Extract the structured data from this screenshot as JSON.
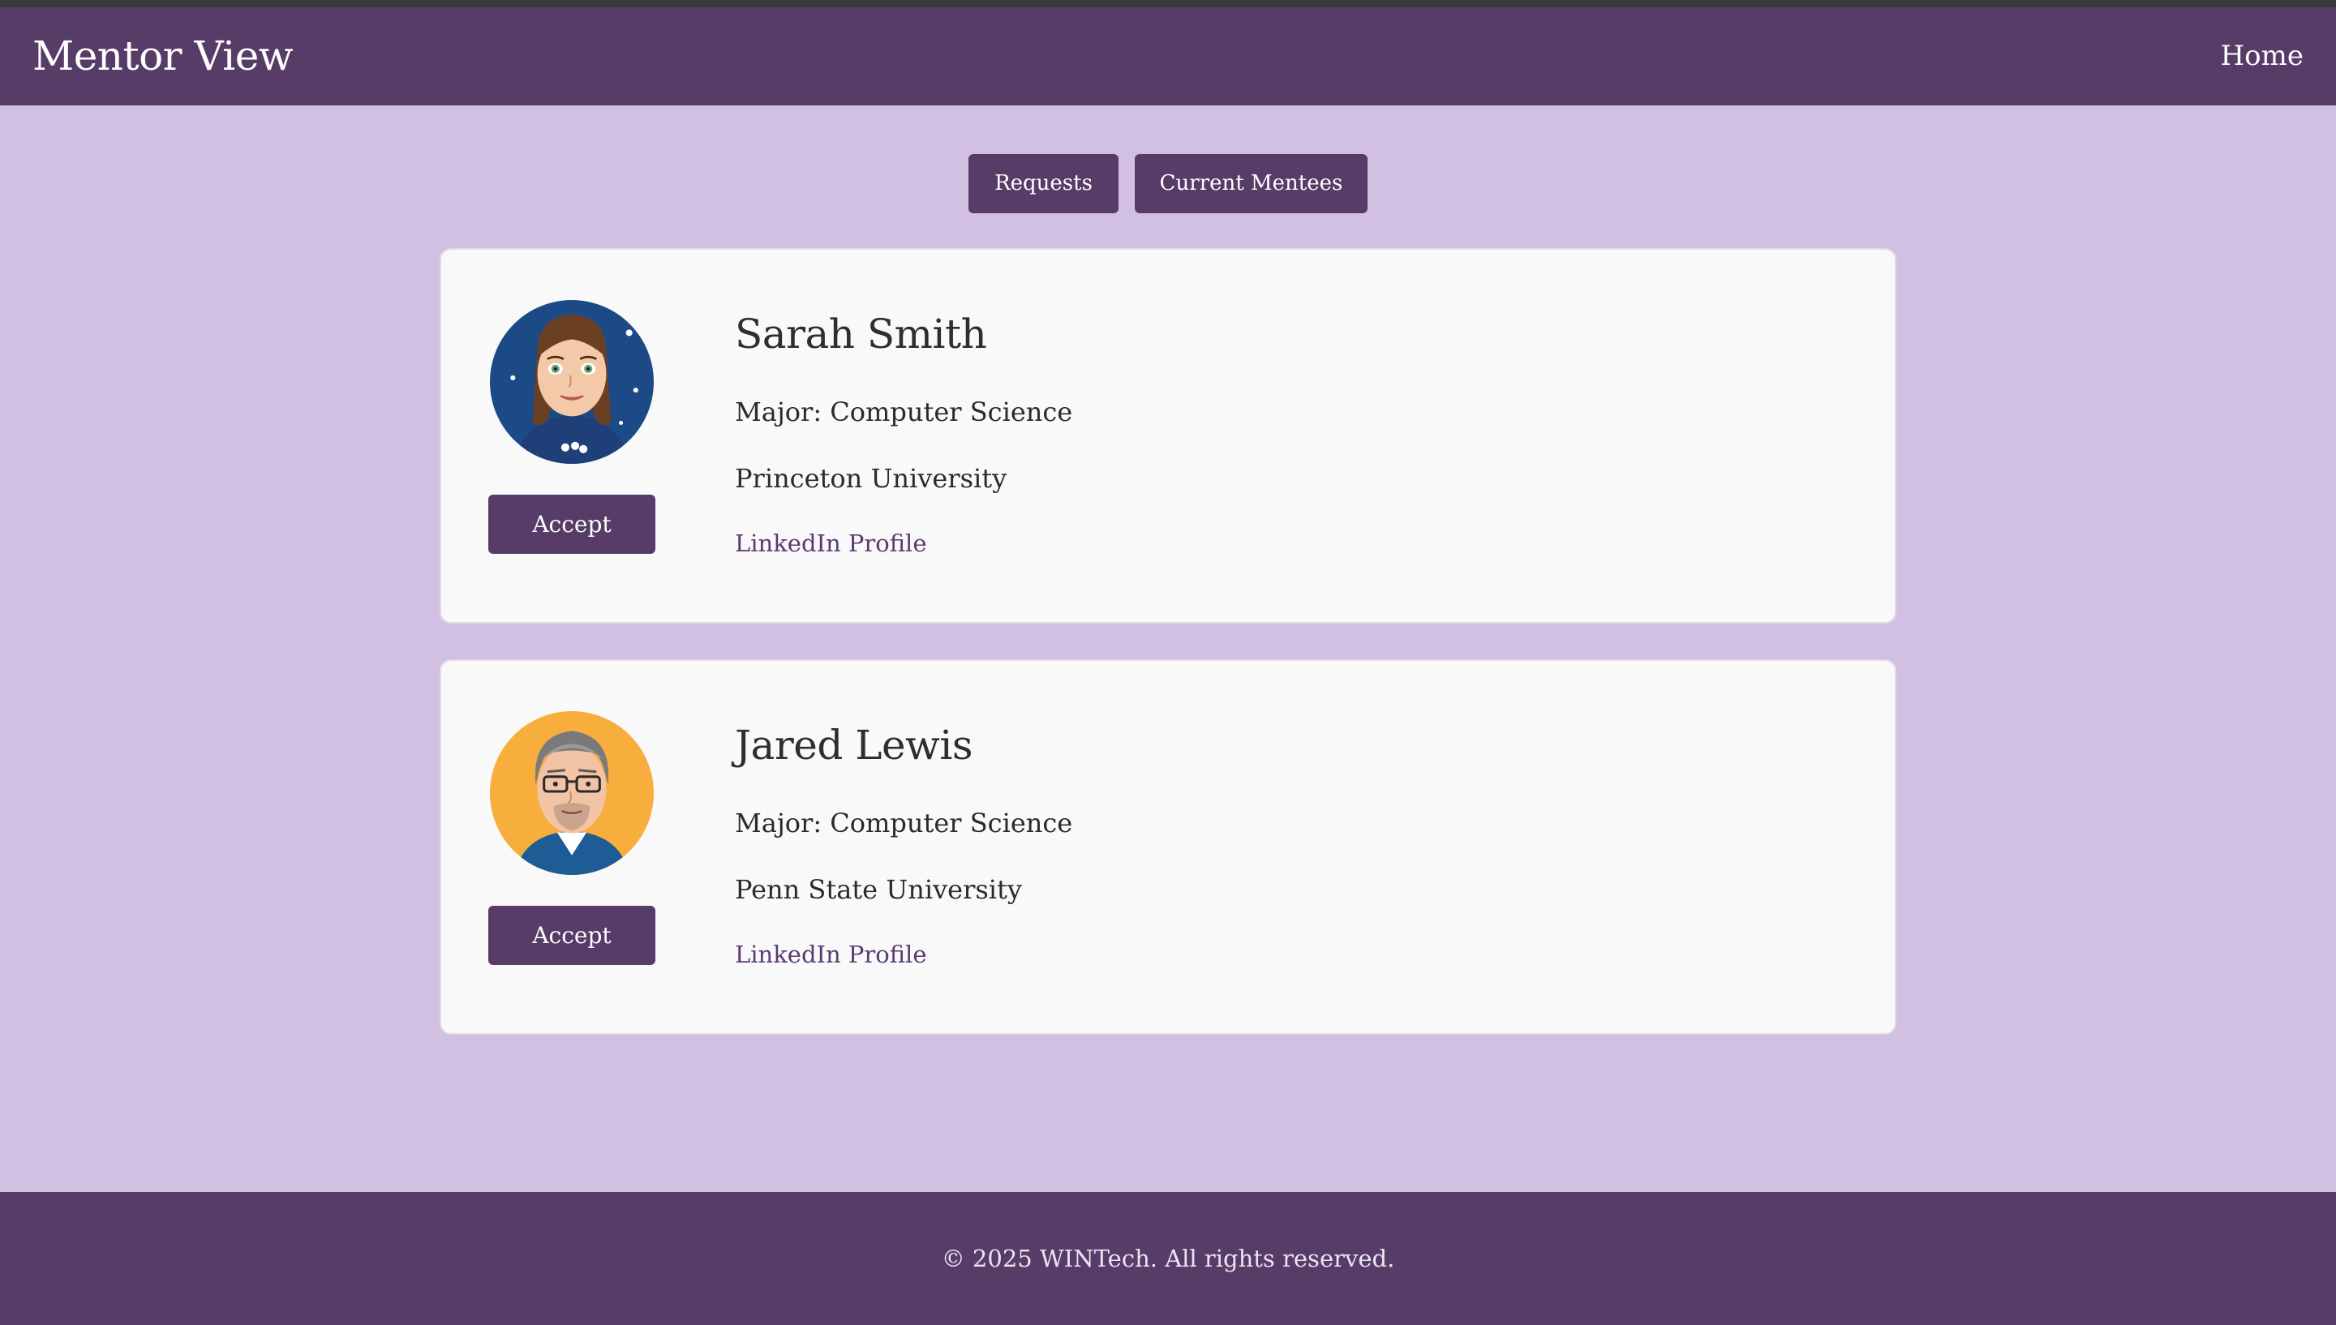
{
  "header": {
    "title": "Mentor View",
    "nav_home": "Home"
  },
  "tabs": [
    {
      "label": "Requests"
    },
    {
      "label": "Current Mentees"
    }
  ],
  "requests": [
    {
      "avatar": "female-avatar-icon",
      "name": "Sarah Smith",
      "major": "Major: Computer Science",
      "school": "Princeton University",
      "linkedin": "LinkedIn Profile",
      "accept_label": "Accept"
    },
    {
      "avatar": "male-avatar-icon",
      "name": "Jared Lewis",
      "major": "Major: Computer Science",
      "school": "Penn State University",
      "linkedin": "LinkedIn Profile",
      "accept_label": "Accept"
    }
  ],
  "footer": {
    "copyright": "© 2025 WINTech. All rights reserved."
  },
  "colors": {
    "brand": "#573c68",
    "background": "#d1c0e1",
    "card": "#f9f9f9",
    "link": "#5a3a72"
  }
}
